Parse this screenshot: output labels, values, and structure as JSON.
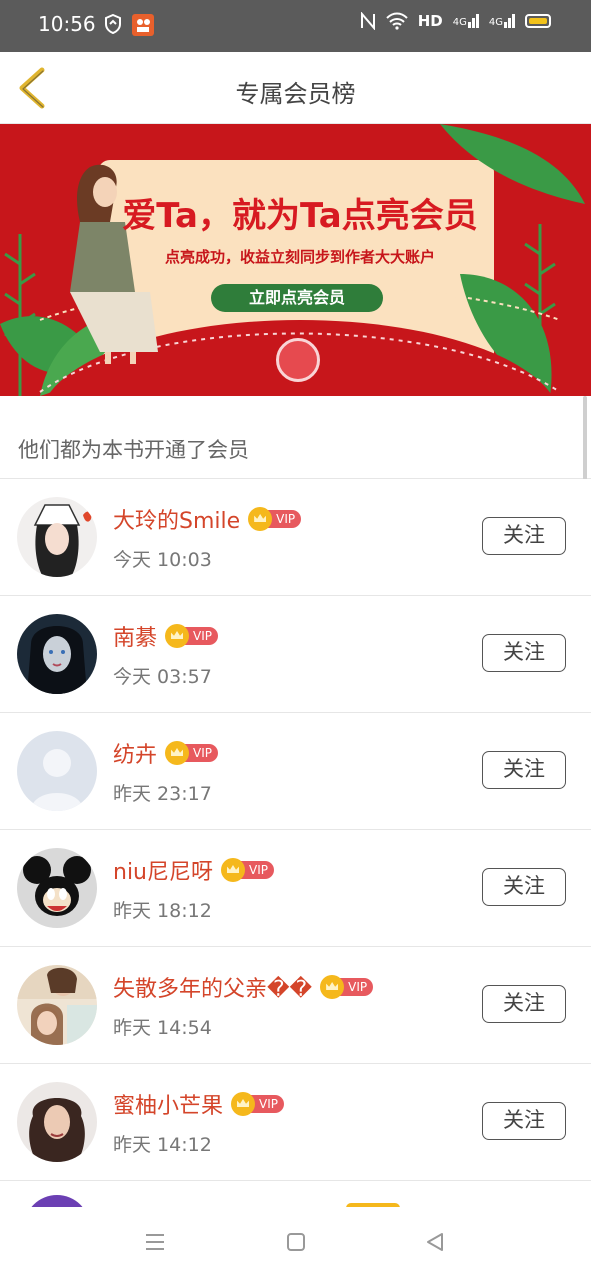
{
  "status_bar": {
    "time": "10:56",
    "network": "HD",
    "signal1": "4G",
    "signal2": "4G",
    "icons": [
      "shield-icon",
      "app-notification-icon",
      "nfc-icon",
      "wifi-icon",
      "battery-icon"
    ],
    "battery_color": "#f2c21b"
  },
  "header": {
    "title": "专属会员榜",
    "back_icon": "back-chevron-icon",
    "back_color": "#e0b52f"
  },
  "banner": {
    "headline": "爱Ta，就为Ta点亮会员",
    "subtitle": "点亮成功，收益立刻同步到作者大大账户",
    "button_label": "立即点亮会员"
  },
  "section": {
    "label": "他们都为本书开通了会员"
  },
  "members": [
    {
      "name": "大玲的Smile",
      "time": "今天 10:03",
      "vip": "VIP",
      "follow": "关注",
      "avatar": "avatar-illustrated-girl"
    },
    {
      "name": "南綦",
      "time": "今天 03:57",
      "vip": "VIP",
      "follow": "关注",
      "avatar": "avatar-dark-hair-girl"
    },
    {
      "name": "纺卉",
      "time": "昨天 23:17",
      "vip": "VIP",
      "follow": "关注",
      "avatar": "avatar-default-silhouette"
    },
    {
      "name": "niu尼尼呀",
      "time": "昨天 18:12",
      "vip": "VIP",
      "follow": "关注",
      "avatar": "avatar-cartoon-mouse"
    },
    {
      "name": "失散多年的父亲��",
      "time": "昨天 14:54",
      "vip": "VIP",
      "follow": "关注",
      "avatar": "avatar-photo-collage"
    },
    {
      "name": "蜜柚小芒果",
      "time": "昨天 14:12",
      "vip": "VIP",
      "follow": "关注",
      "avatar": "avatar-curly-hair-girl"
    }
  ],
  "nav_bar": {
    "icons": [
      "menu-icon",
      "home-square-icon",
      "back-triangle-icon"
    ]
  },
  "colors": {
    "accent_name": "#d4452a",
    "vip_badge": "#e7595e",
    "vip_crown": "#f5b81c",
    "banner_red": "#c7161b",
    "banner_button": "#2f7d3a"
  }
}
